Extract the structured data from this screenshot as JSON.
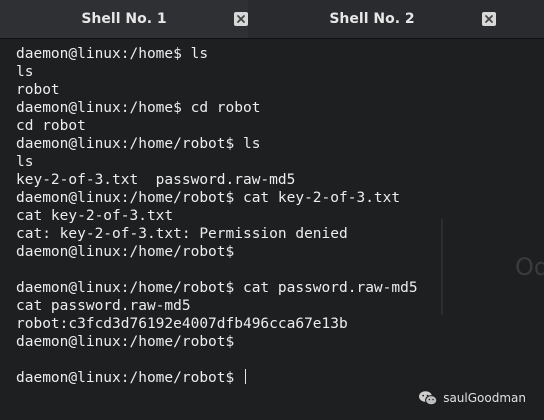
{
  "tabs": [
    {
      "label": "Shell No. 1"
    },
    {
      "label": "Shell No. 2"
    }
  ],
  "terminal": {
    "lines": [
      "daemon@linux:/home$ ls",
      "ls",
      "robot",
      "daemon@linux:/home$ cd robot",
      "cd robot",
      "daemon@linux:/home/robot$ ls",
      "ls",
      "key-2-of-3.txt  password.raw-md5",
      "daemon@linux:/home/robot$ cat key-2-of-3.txt",
      "cat key-2-of-3.txt",
      "cat: key-2-of-3.txt: Permission denied",
      "daemon@linux:/home/robot$",
      "",
      "daemon@linux:/home/robot$ cat password.raw-md5",
      "cat password.raw-md5",
      "robot:c3fcd3d76192e4007dfb496cca67e13b",
      "daemon@linux:/home/robot$",
      "",
      "daemon@linux:/home/robot$ "
    ],
    "background_ghost_text": "Od"
  },
  "watermark": {
    "icon": "wechat-icon",
    "text": "saulGoodman"
  },
  "colors": {
    "background": "#1e1f21",
    "tabbar": "#2a2b2e",
    "text": "#ededed"
  }
}
